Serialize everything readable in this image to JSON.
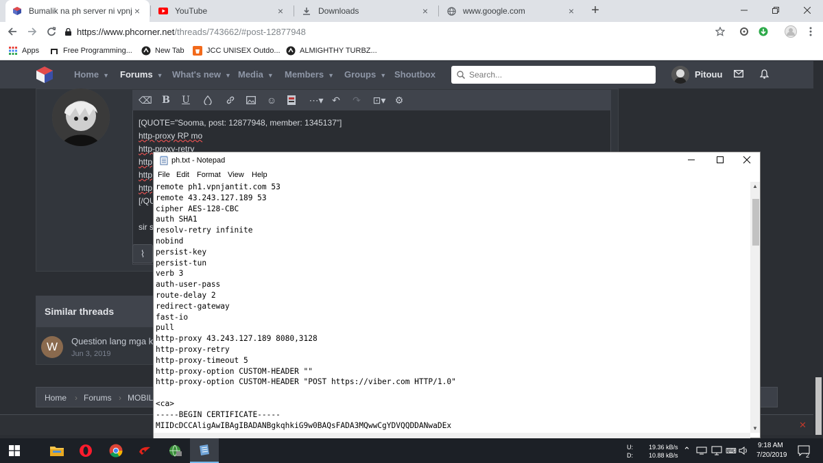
{
  "browser": {
    "tabs": [
      {
        "title": "Bumalik na ph server ni vpnjantit",
        "close": "×",
        "active": true
      },
      {
        "title": "YouTube",
        "close": "×",
        "active": false
      },
      {
        "title": "Downloads",
        "close": "×",
        "active": false
      },
      {
        "title": "www.google.com",
        "close": "×",
        "active": false
      }
    ],
    "new_tab": "+",
    "url_host": "https://www.phcorner.net",
    "url_path": "/threads/743662/#post-12877948",
    "bookmarks": [
      "Apps",
      "Free Programming...",
      "New Tab",
      "JCC UNISEX Outdo...",
      "ALMIGHTHY TURBZ..."
    ]
  },
  "forum": {
    "nav": [
      {
        "label": "Home",
        "caret": true,
        "active": false
      },
      {
        "label": "Forums",
        "caret": true,
        "active": true
      },
      {
        "label": "What's new",
        "caret": true,
        "active": false
      },
      {
        "label": "Media",
        "caret": true,
        "active": false
      },
      {
        "label": "Members",
        "caret": true,
        "active": false
      },
      {
        "label": "Groups",
        "caret": true,
        "active": false
      },
      {
        "label": "Shoutbox",
        "caret": false,
        "active": false
      }
    ],
    "search_placeholder": "Search...",
    "username": "Pitouu",
    "editor_lines": [
      "[QUOTE=\"Sooma, post: 12877948, member: 1345137\"]",
      "http-proxy RP mo",
      "http-proxy-retry",
      "http",
      "http",
      "http",
      "[/QU",
      "",
      "sir s"
    ],
    "similar_heading": "Similar threads",
    "similar_avatar": "W",
    "similar_title": "Question lang mga k",
    "similar_date": "Jun 3, 2019",
    "breadcrumbs": [
      "Home",
      "Forums",
      "MOBIL"
    ]
  },
  "notepad": {
    "title": "ph.txt - Notepad",
    "menu": [
      "File",
      "Edit",
      "Format",
      "View",
      "Help"
    ],
    "lines": [
      "remote ph1.vpnjantit.com 53",
      "remote 43.243.127.189 53",
      "cipher AES-128-CBC",
      "auth SHA1",
      "resolv-retry infinite",
      "nobind",
      "persist-key",
      "persist-tun",
      "verb 3",
      "auth-user-pass",
      "route-delay 2",
      "redirect-gateway",
      "fast-io",
      "pull",
      "http-proxy 43.243.127.189 8080,3128",
      "http-proxy-retry",
      "http-proxy-timeout 5",
      "http-proxy-option CUSTOM-HEADER \"\"",
      "http-proxy-option CUSTOM-HEADER \"POST https://viber.com HTTP/1.0\"",
      "",
      "<ca>",
      "-----BEGIN CERTIFICATE-----",
      "MIIDcDCCAligAwIBAgIBADANBgkqhkiG9w0BAQsFADA3MQwwCgYDVQQDDANwaDEx"
    ]
  },
  "taskbar": {
    "upload_label": "U:",
    "download_label": "D:",
    "upload_speed": "19.36 kB/s",
    "download_speed": "10.88 kB/s",
    "time": "9:18 AM",
    "date": "7/20/2019",
    "notifications": "2"
  }
}
